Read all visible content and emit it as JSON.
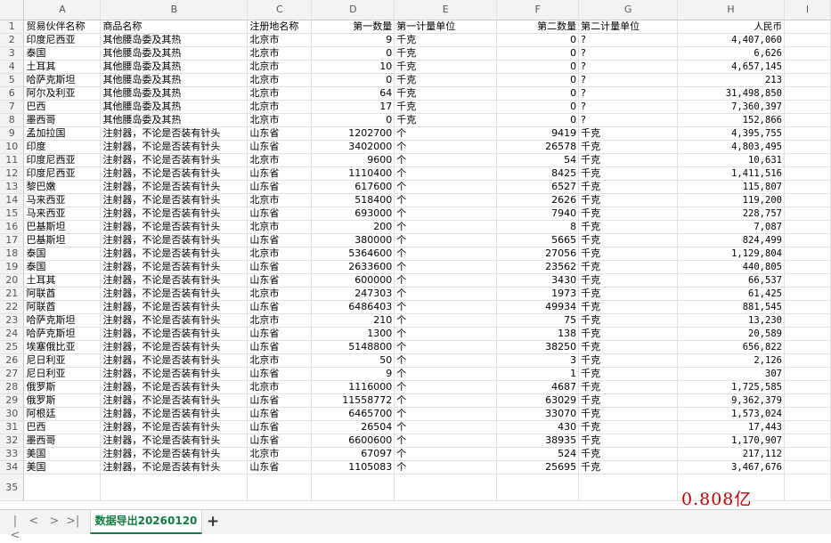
{
  "columns": [
    "A",
    "B",
    "C",
    "D",
    "E",
    "F",
    "G",
    "H",
    "I"
  ],
  "header_row": [
    "贸易伙伴名称",
    "商品名称",
    "注册地名称",
    "第一数量",
    "第一计量单位",
    "第二数量",
    "第二计量单位",
    "人民币"
  ],
  "rows": [
    [
      "印度尼西亚",
      "其他腰岛委及其热",
      "北京市",
      "9",
      "千克",
      "0",
      "?",
      "4,407,060"
    ],
    [
      "泰国",
      "其他腰岛委及其热",
      "北京市",
      "0",
      "千克",
      "0",
      "?",
      "6,626"
    ],
    [
      "土耳其",
      "其他腰岛委及其热",
      "北京市",
      "10",
      "千克",
      "0",
      "?",
      "4,657,145"
    ],
    [
      "哈萨克斯坦",
      "其他腰岛委及其热",
      "北京市",
      "0",
      "千克",
      "0",
      "?",
      "213"
    ],
    [
      "阿尔及利亚",
      "其他腰岛委及其热",
      "北京市",
      "64",
      "千克",
      "0",
      "?",
      "31,498,850"
    ],
    [
      "巴西",
      "其他腰岛委及其热",
      "北京市",
      "17",
      "千克",
      "0",
      "?",
      "7,360,397"
    ],
    [
      "墨西哥",
      "其他腰岛委及其热",
      "北京市",
      "0",
      "千克",
      "0",
      "?",
      "152,866"
    ],
    [
      "孟加拉国",
      "注射器，不论是否装有针头",
      "山东省",
      "1202700",
      "个",
      "9419",
      "千克",
      "4,395,755"
    ],
    [
      "印度",
      "注射器，不论是否装有针头",
      "山东省",
      "3402000",
      "个",
      "26578",
      "千克",
      "4,803,495"
    ],
    [
      "印度尼西亚",
      "注射器，不论是否装有针头",
      "北京市",
      "9600",
      "个",
      "54",
      "千克",
      "10,631"
    ],
    [
      "印度尼西亚",
      "注射器，不论是否装有针头",
      "山东省",
      "1110400",
      "个",
      "8425",
      "千克",
      "1,411,516"
    ],
    [
      "黎巴嫩",
      "注射器，不论是否装有针头",
      "山东省",
      "617600",
      "个",
      "6527",
      "千克",
      "115,807"
    ],
    [
      "马来西亚",
      "注射器，不论是否装有针头",
      "北京市",
      "518400",
      "个",
      "2626",
      "千克",
      "119,200"
    ],
    [
      "马来西亚",
      "注射器，不论是否装有针头",
      "山东省",
      "693000",
      "个",
      "7940",
      "千克",
      "228,757"
    ],
    [
      "巴基斯坦",
      "注射器，不论是否装有针头",
      "北京市",
      "200",
      "个",
      "8",
      "千克",
      "7,087"
    ],
    [
      "巴基斯坦",
      "注射器，不论是否装有针头",
      "山东省",
      "380000",
      "个",
      "5665",
      "千克",
      "824,499"
    ],
    [
      "泰国",
      "注射器，不论是否装有针头",
      "北京市",
      "5364600",
      "个",
      "27056",
      "千克",
      "1,129,804"
    ],
    [
      "泰国",
      "注射器，不论是否装有针头",
      "山东省",
      "2633600",
      "个",
      "23562",
      "千克",
      "440,805"
    ],
    [
      "土耳其",
      "注射器，不论是否装有针头",
      "山东省",
      "600000",
      "个",
      "3430",
      "千克",
      "66,537"
    ],
    [
      "阿联酋",
      "注射器，不论是否装有针头",
      "北京市",
      "247303",
      "个",
      "1973",
      "千克",
      "61,425"
    ],
    [
      "阿联酋",
      "注射器，不论是否装有针头",
      "山东省",
      "6486403",
      "个",
      "49934",
      "千克",
      "881,545"
    ],
    [
      "哈萨克斯坦",
      "注射器，不论是否装有针头",
      "北京市",
      "210",
      "个",
      "75",
      "千克",
      "13,230"
    ],
    [
      "哈萨克斯坦",
      "注射器，不论是否装有针头",
      "山东省",
      "1300",
      "个",
      "138",
      "千克",
      "20,589"
    ],
    [
      "埃塞俄比亚",
      "注射器，不论是否装有针头",
      "山东省",
      "5148800",
      "个",
      "38250",
      "千克",
      "656,822"
    ],
    [
      "尼日利亚",
      "注射器，不论是否装有针头",
      "北京市",
      "50",
      "个",
      "3",
      "千克",
      "2,126"
    ],
    [
      "尼日利亚",
      "注射器，不论是否装有针头",
      "山东省",
      "9",
      "个",
      "1",
      "千克",
      "307"
    ],
    [
      "俄罗斯",
      "注射器，不论是否装有针头",
      "北京市",
      "1116000",
      "个",
      "4687",
      "千克",
      "1,725,585"
    ],
    [
      "俄罗斯",
      "注射器，不论是否装有针头",
      "山东省",
      "11558772",
      "个",
      "63029",
      "千克",
      "9,362,379"
    ],
    [
      "阿根廷",
      "注射器，不论是否装有针头",
      "山东省",
      "6465700",
      "个",
      "33070",
      "千克",
      "1,573,024"
    ],
    [
      "巴西",
      "注射器，不论是否装有针头",
      "山东省",
      "26504",
      "个",
      "430",
      "千克",
      "17,443"
    ],
    [
      "墨西哥",
      "注射器，不论是否装有针头",
      "山东省",
      "6600600",
      "个",
      "38935",
      "千克",
      "1,170,907"
    ],
    [
      "美国",
      "注射器，不论是否装有针头",
      "北京市",
      "67097",
      "个",
      "524",
      "千克",
      "217,112"
    ],
    [
      "美国",
      "注射器，不论是否装有针头",
      "山东省",
      "1105083",
      "个",
      "25695",
      "千克",
      "3,467,676"
    ]
  ],
  "row35_label": "35",
  "annotation": "0.808亿",
  "sheet_tab": "数据导出20260120",
  "nav_glyphs": {
    "first": "|<",
    "prev": "<",
    "next": ">",
    "last": ">|"
  },
  "add_tab_glyph": "+"
}
